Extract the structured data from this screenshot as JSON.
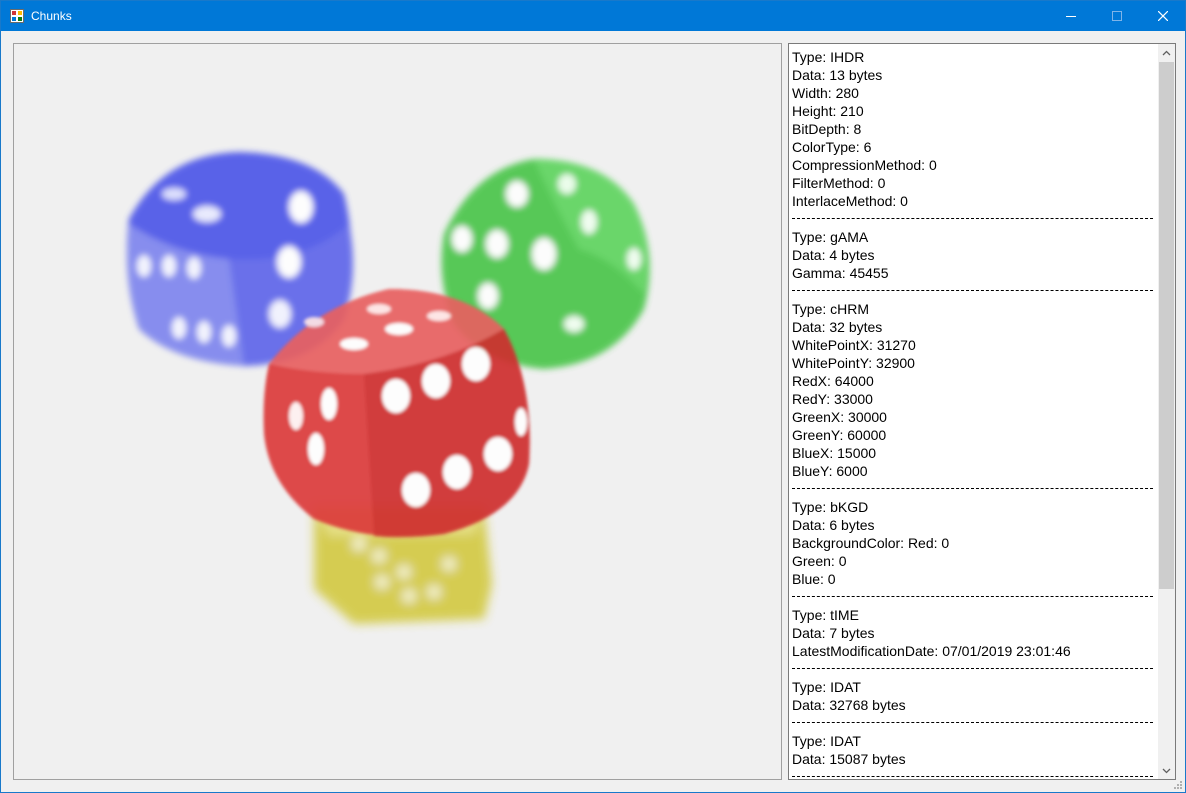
{
  "window": {
    "title": "Chunks",
    "controls": {
      "minimize": "minimize",
      "maximize": "maximize",
      "close": "close"
    }
  },
  "picture": {
    "description_icon": "dice-image"
  },
  "chunk_list": {
    "items": [
      "Type: IHDR",
      "Data: 13 bytes",
      "Width: 280",
      "Height: 210",
      "BitDepth: 8",
      "ColorType: 6",
      "CompressionMethod: 0",
      "FilterMethod: 0",
      "InterlaceMethod: 0",
      "-----",
      "Type: gAMA",
      "Data: 4 bytes",
      "Gamma: 45455",
      "-----",
      "Type: cHRM",
      "Data: 32 bytes",
      "WhitePointX: 31270",
      "WhitePointY: 32900",
      "RedX: 64000",
      "RedY: 33000",
      "GreenX: 30000",
      "GreenY: 60000",
      "BlueX: 15000",
      "BlueY: 6000",
      "-----",
      "Type: bKGD",
      "Data: 6 bytes",
      "BackgroundColor: Red: 0",
      "Green: 0",
      "Blue: 0",
      "-----",
      "Type: tIME",
      "Data: 7 bytes",
      "LatestModificationDate: 07/01/2019 23:01:46",
      "-----",
      "Type: IDAT",
      "Data: 32768 bytes",
      "-----",
      "Type: IDAT",
      "Data: 15087 bytes",
      "-----"
    ]
  },
  "colors": {
    "titlebar": "#0078d7",
    "dice_blue": "#4a52e8",
    "dice_green": "#3cc23c",
    "dice_red": "#dc3a3a",
    "dice_yellow": "#cfc42a"
  }
}
